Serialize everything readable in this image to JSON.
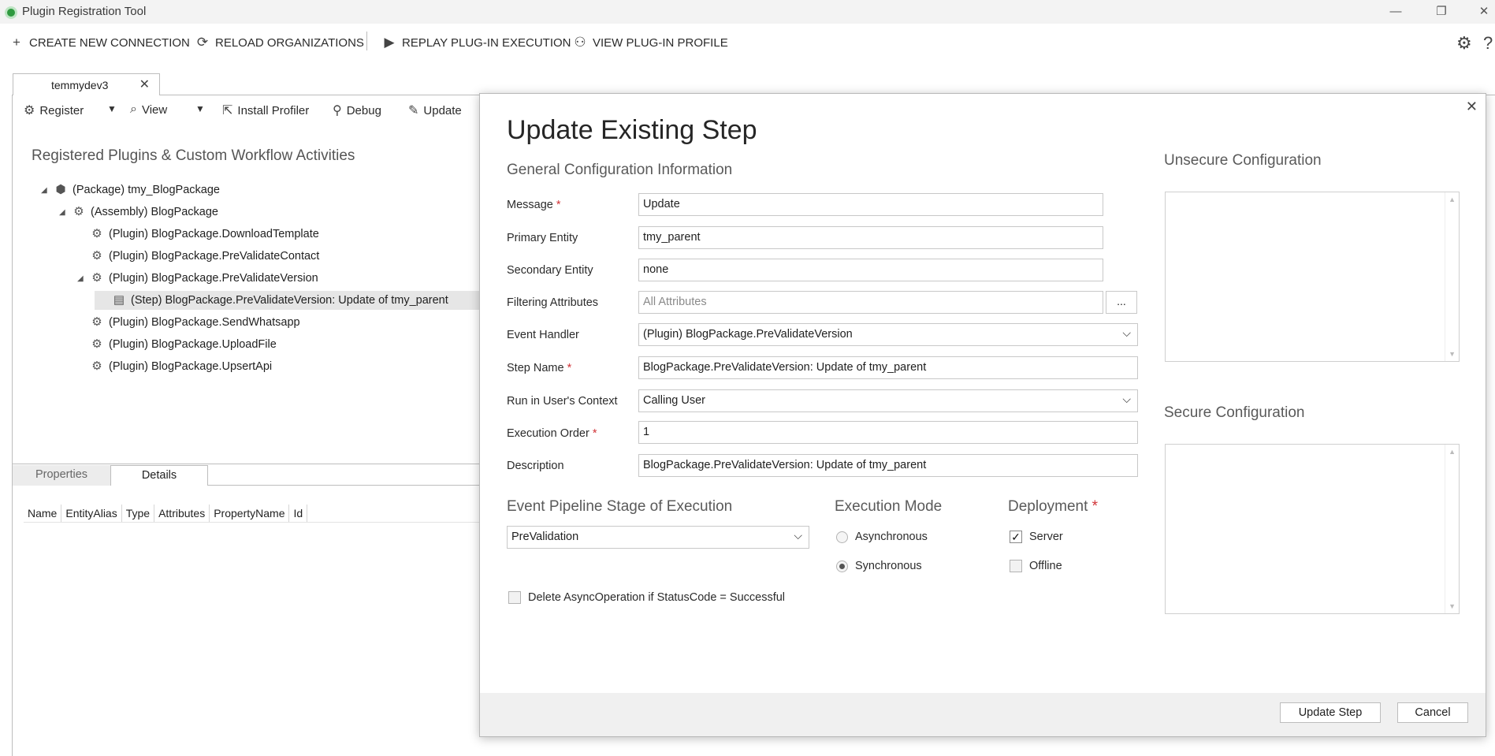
{
  "window": {
    "title": "Plugin Registration Tool",
    "controls": [
      "—",
      "❐",
      "✕"
    ]
  },
  "commands": [
    {
      "label": "CREATE NEW CONNECTION",
      "icon": "plus-icon",
      "glyph": "+"
    },
    {
      "label": "RELOAD ORGANIZATIONS",
      "icon": "reload-icon",
      "glyph": "⟳"
    },
    {
      "label": "REPLAY PLUG-IN EXECUTION",
      "icon": "replay-icon",
      "glyph": "▶"
    },
    {
      "label": "VIEW PLUG-IN PROFILE",
      "icon": "profile-icon",
      "glyph": "⚇"
    }
  ],
  "corner": {
    "settings_glyph": "⚙",
    "help_glyph": "?"
  },
  "connection_tab": {
    "label": "temmydev3",
    "close": "✕"
  },
  "toolbar": {
    "register": "Register",
    "view": "View",
    "install_profiler": "Install Profiler",
    "debug": "Debug",
    "update": "Update",
    "dropdown_arrow": "▼"
  },
  "tree": {
    "title": "Registered Plugins & Custom Workflow Activities",
    "package": "(Package) tmy_BlogPackage",
    "assembly": "(Assembly) BlogPackage",
    "plugin_download": "(Plugin) BlogPackage.DownloadTemplate",
    "plugin_contact": "(Plugin) BlogPackage.PreValidateContact",
    "plugin_version": "(Plugin) BlogPackage.PreValidateVersion",
    "step": "(Step) BlogPackage.PreValidateVersion: Update of tmy_parent",
    "plugin_whatsapp": "(Plugin) BlogPackage.SendWhatsapp",
    "plugin_upload": "(Plugin) BlogPackage.UploadFile",
    "plugin_upsert": "(Plugin) BlogPackage.UpsertApi"
  },
  "bottom_tabs": {
    "properties": "Properties",
    "details": "Details"
  },
  "details_columns": [
    "Name",
    "EntityAlias",
    "Type",
    "Attributes",
    "PropertyName",
    "Id"
  ],
  "dialog": {
    "close": "✕",
    "title": "Update Existing Step",
    "general_section": "General Configuration Information",
    "required_mark": "*",
    "fields": {
      "message_label": "Message",
      "message_value": "Update",
      "primary_entity_label": "Primary Entity",
      "primary_entity_value": "tmy_parent",
      "secondary_entity_label": "Secondary Entity",
      "secondary_entity_value": "none",
      "filtering_label": "Filtering Attributes",
      "filtering_placeholder": "All Attributes",
      "filtering_button": "...",
      "event_handler_label": "Event Handler",
      "event_handler_value": "(Plugin) BlogPackage.PreValidateVersion",
      "step_name_label": "Step Name",
      "step_name_value": "BlogPackage.PreValidateVersion: Update of tmy_parent",
      "run_context_label": "Run in User's Context",
      "run_context_value": "Calling User",
      "execution_order_label": "Execution Order",
      "execution_order_value": "1",
      "description_label": "Description",
      "description_value": "BlogPackage.PreValidateVersion: Update of tmy_parent"
    },
    "pipeline": {
      "title": "Event Pipeline Stage of Execution",
      "value": "PreValidation"
    },
    "execution_mode": {
      "title": "Execution Mode",
      "async": "Asynchronous",
      "sync": "Synchronous",
      "selected": "Synchronous"
    },
    "deployment": {
      "title": "Deployment",
      "server": "Server",
      "offline": "Offline",
      "server_checked": true,
      "offline_checked": false
    },
    "delete_async": "Delete AsyncOperation if StatusCode = Successful",
    "unsecure_config": "Unsecure  Configuration",
    "secure_config": "Secure  Configuration",
    "update_button": "Update Step",
    "cancel_button": "Cancel",
    "chevron": "⌵"
  }
}
